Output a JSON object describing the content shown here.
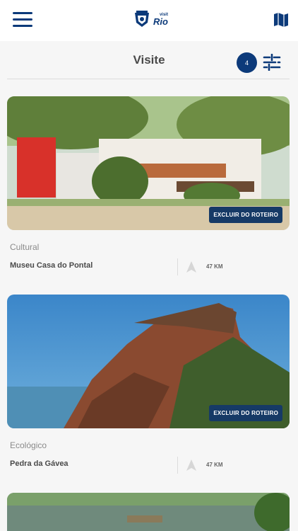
{
  "topbar": {
    "menu_icon": "hamburger-menu-icon",
    "logo_small": "visit",
    "logo_big": "Rio",
    "map_icon": "map-icon"
  },
  "header": {
    "title": "Visite",
    "count": "4",
    "filter_icon": "filter-sliders-icon"
  },
  "colors": {
    "brand": "#0c3a7a",
    "remove_button": "#163a66",
    "background": "#f6f6f6"
  },
  "places": [
    {
      "category": "Cultural",
      "name": "Museu Casa do Pontal",
      "distance": "47 KM",
      "remove_label": "EXCLUIR DO ROTEIRO"
    },
    {
      "category": "Ecológico",
      "name": "Pedra da Gávea",
      "distance": "47 KM",
      "remove_label": "EXCLUIR DO ROTEIRO"
    }
  ]
}
